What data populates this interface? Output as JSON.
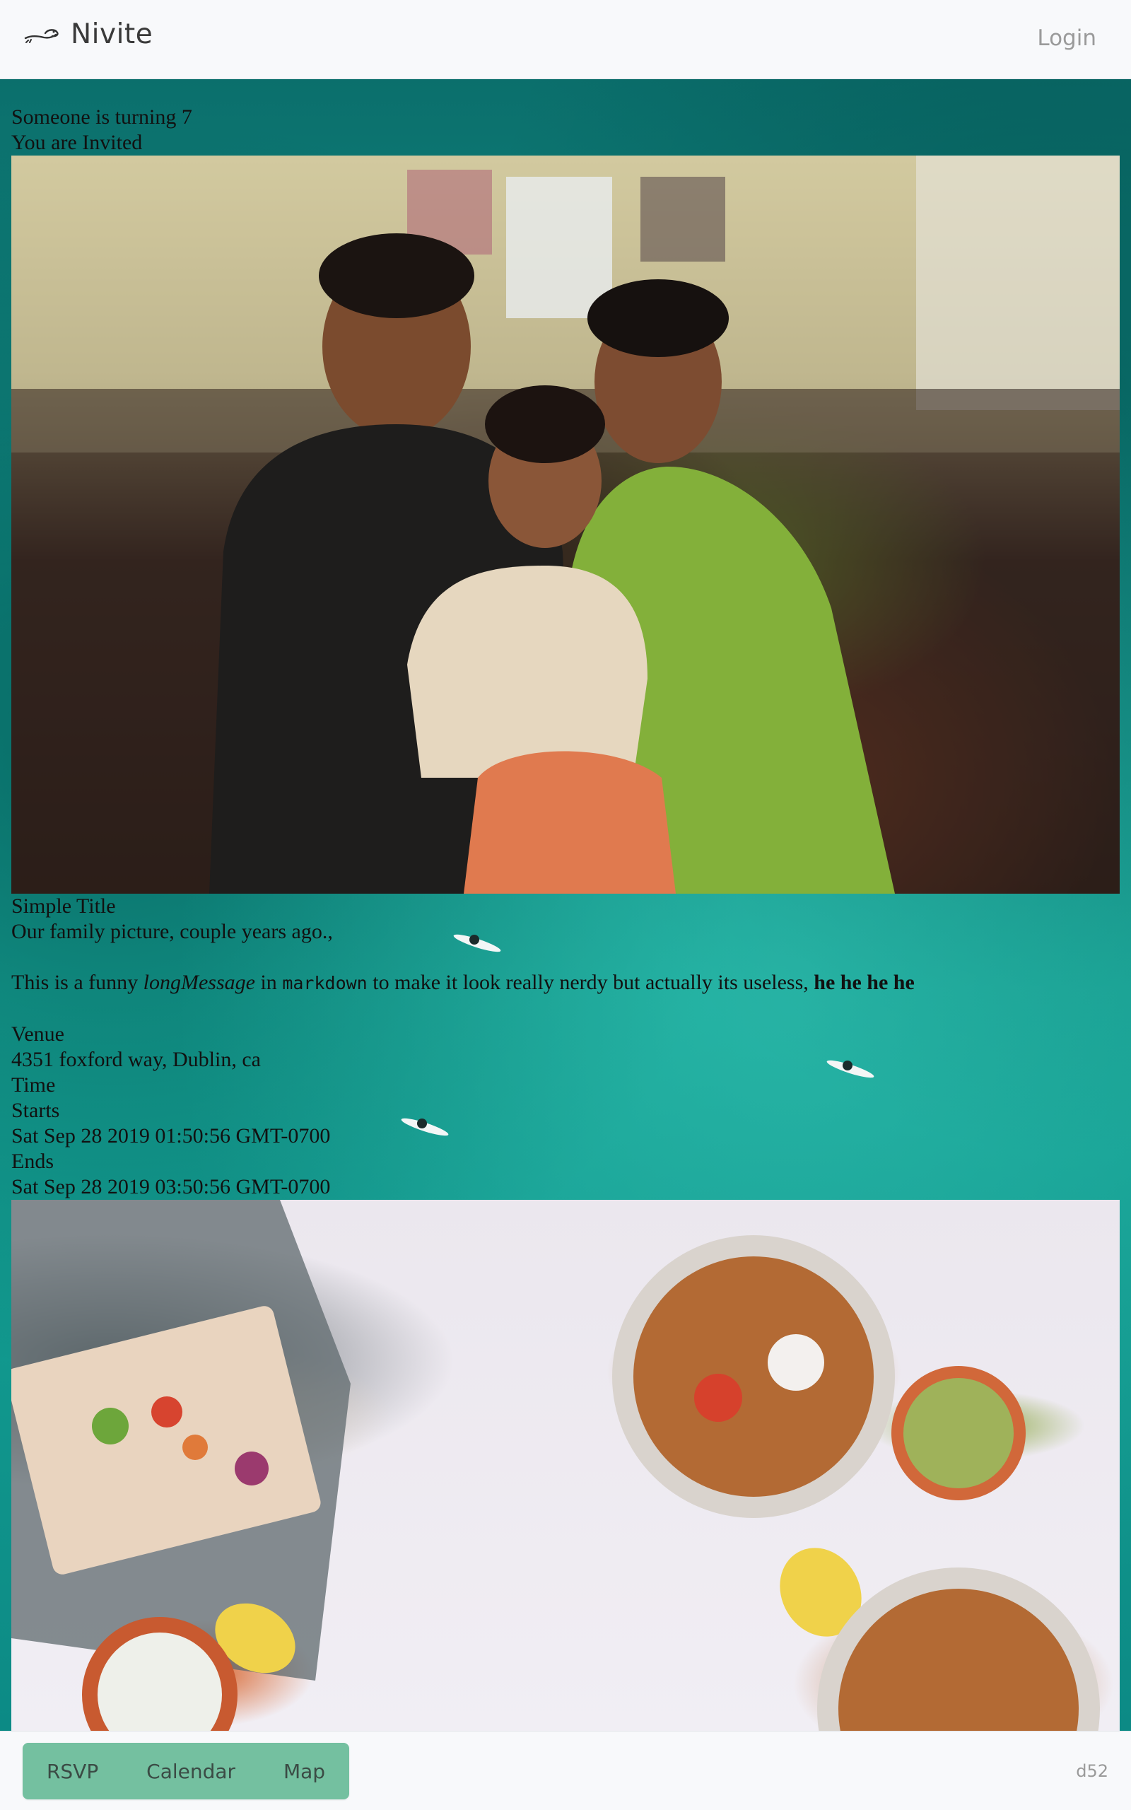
{
  "header": {
    "brand_name": "Nivite",
    "logo_icon": "seal-icon",
    "login_label": "Login"
  },
  "invite": {
    "turning_text": "Someone is turning 7",
    "invited_text": "You are Invited",
    "family_photo_alt": "family-photo",
    "photo_title": "Simple Title",
    "photo_caption": "Our family picture, couple years ago.,",
    "long_message": {
      "part1": "This is a funny ",
      "emphasis": "longMessage",
      "part2": " in ",
      "code": "markdown",
      "part3": " to make it look really nerdy but actually its useless, ",
      "bold": "he he he he"
    },
    "venue_label": "Venue",
    "venue_value": "4351 foxford way, Dublin, ca",
    "time_label": "Time",
    "starts_label": "Starts",
    "starts_value": "Sat Sep 28 2019 01:50:56 GMT-0700",
    "ends_label": "Ends",
    "ends_value": "Sat Sep 28 2019 03:50:56 GMT-0700",
    "food_photo_alt": "food-photo"
  },
  "footer": {
    "rsvp_label": "RSVP",
    "calendar_label": "Calendar",
    "map_label": "Map",
    "build_id": "d52"
  },
  "colors": {
    "header_bg": "#f8f9fb",
    "theme_teal": "#12998c",
    "button_group_bg": "#74c0a0",
    "text_dark": "#111111",
    "text_muted": "#9a9a9a"
  }
}
